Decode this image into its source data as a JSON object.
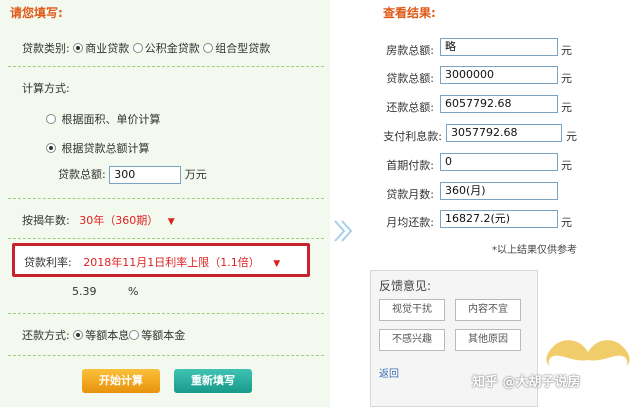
{
  "left": {
    "title": "请您填写:",
    "loan_type_label": "贷款类别:",
    "loan_types": [
      "商业贷款",
      "公积金贷款",
      "组合型贷款"
    ],
    "calc_method_label": "计算方式:",
    "calc_option_area": "根据面积、单价计算",
    "calc_option_total": "根据贷款总额计算",
    "loan_total_label": "贷款总额:",
    "loan_total_value": "300",
    "loan_total_unit": "万元",
    "years_label": "按揭年数:",
    "years_value": "30年（360期）",
    "rate_label": "贷款利率:",
    "rate_value": "2018年11月1日利率上限（1.1倍）",
    "rate_number": "5.39",
    "rate_unit": "%",
    "repay_label": "还款方式:",
    "repay_options": [
      "等额本息",
      "等额本金"
    ],
    "btn_calc": "开始计算",
    "btn_reset": "重新填写"
  },
  "right": {
    "title": "查看结果:",
    "rows": [
      {
        "label": "房款总额:",
        "value": "略",
        "unit": "元"
      },
      {
        "label": "贷款总额:",
        "value": "3000000",
        "unit": "元"
      },
      {
        "label": "还款总额:",
        "value": "6057792.68",
        "unit": "元"
      },
      {
        "label": "支付利息款:",
        "value": "3057792.68",
        "unit": "元"
      },
      {
        "label": "首期付款:",
        "value": "0",
        "unit": "元"
      },
      {
        "label": "贷款月数:",
        "value": "360(月)",
        "unit": ""
      },
      {
        "label": "月均还款:",
        "value": "16827.2(元)",
        "unit": "元"
      }
    ],
    "note": "*以上结果仅供参考",
    "feedback": {
      "title": "反馈意见:",
      "buttons": [
        "视觉干扰",
        "内容不宜",
        "不感兴趣",
        "其他原因"
      ],
      "back": "返回"
    }
  },
  "watermark": "知乎 @大胡子说房",
  "colors": {
    "accent": "#e05a1a",
    "highlight_border": "#c8232c",
    "panel_bg": "#f3f9ee"
  }
}
